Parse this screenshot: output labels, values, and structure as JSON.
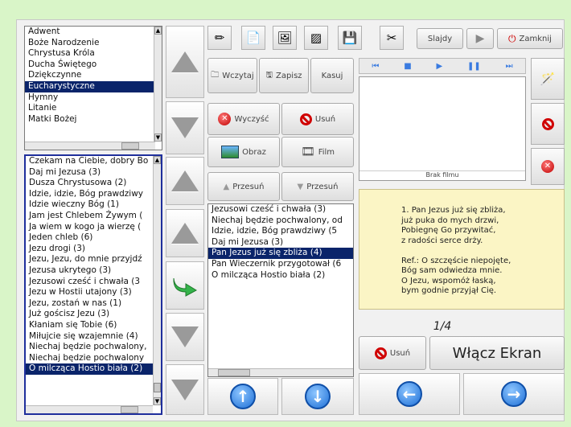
{
  "categories": {
    "items": [
      "Adwent",
      "Boże Narodzenie",
      "Chrystusa Króla",
      "Ducha Świętego",
      "Dziękczynne",
      "Eucharystyczne",
      "Hymny",
      "Litanie",
      "Matki Bożej"
    ],
    "selected_index": 5
  },
  "songs": {
    "items": [
      "Czekam na Ciebie, dobry Bo",
      "Daj mi Jezusa (3)",
      "Dusza Chrystusowa (2)",
      "Idzie, idzie, Bóg prawdziwy",
      "Idzie wieczny Bóg (1)",
      "Jam jest Chlebem Żywym (",
      "Ja wiem w kogo ja wierzę (",
      "Jeden chleb (6)",
      "Jezu drogi (3)",
      "Jezu, Jezu, do mnie przyjdź",
      "Jezusa ukrytego (3)",
      "Jezusowi cześć i chwała (3",
      "Jezu w Hostii utajony (3)",
      "Jezu, zostań w nas (1)",
      "Już gościsz Jezu (3)",
      "Kłaniam się Tobie (6)",
      "Miłujcie się wzajemnie (4)",
      "Niechaj będzie pochwalony,",
      "Niechaj będzie pochwalony",
      "O milcząca Hostio biała (2)"
    ],
    "selected_index": 19
  },
  "toolbar": {
    "slajdy_label": "Slajdy",
    "zamknij_label": "Zamknij"
  },
  "tabs": {
    "wczytaj": "Wczytaj",
    "zapisz": "Zapisz",
    "kasuj": "Kasuj"
  },
  "actions": {
    "wyczysc": "Wyczyść",
    "usun": "Usuń",
    "obraz": "Obraz",
    "film": "Film",
    "przesun_up": "Przesuń",
    "przesun_down": "Przesuń"
  },
  "playlist": {
    "items": [
      "Jezusowi cześć i chwała (3)",
      "Niechaj będzie pochwalony, od",
      "Idzie, idzie, Bóg prawdziwy (5",
      "Daj mi Jezusa (3)",
      "Pan Jezus już się zbliża (4)",
      "Pan Wieczernik przygotował (6",
      "O milcząca Hostio biała (2)"
    ],
    "selected_index": 4
  },
  "preview": {
    "caption": "Brak filmu"
  },
  "lyrics": {
    "lines": [
      "1. Pan Jezus już się zbliża,",
      "już puka do mych drzwi,",
      "Pobiegnę Go przywitać,",
      "z radości serce drży.",
      "",
      "Ref.: O szczęście niepojęte,",
      "Bóg sam odwiedza mnie.",
      "O Jezu, wspomóż łaską,",
      "bym godnie przyjął Cię."
    ]
  },
  "slide_counter": "1/4",
  "bottom": {
    "usun_label": "Usuń",
    "wlacz_ekran_label": "Włącz Ekran"
  },
  "colors": {
    "background": "#d9f5c8",
    "selection": "#0a246a",
    "lyrics_bg": "#fbf5c5",
    "accent_blue": "#1d6fd6",
    "danger_red": "#d00000"
  }
}
